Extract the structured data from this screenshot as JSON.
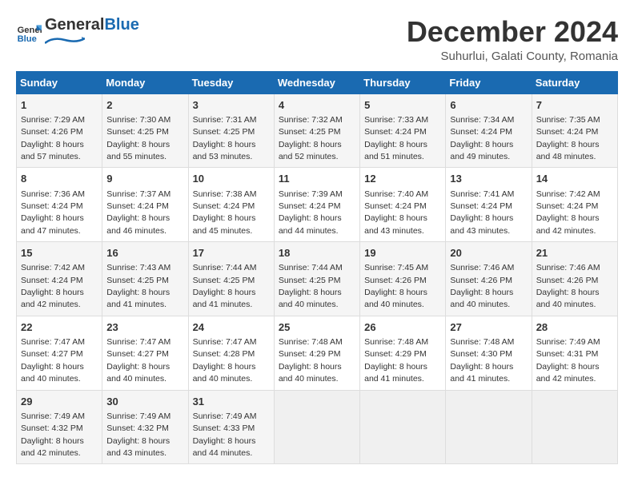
{
  "logo": {
    "text_general": "General",
    "text_blue": "Blue"
  },
  "title": "December 2024",
  "subtitle": "Suhurlui, Galati County, Romania",
  "weekdays": [
    "Sunday",
    "Monday",
    "Tuesday",
    "Wednesday",
    "Thursday",
    "Friday",
    "Saturday"
  ],
  "weeks": [
    [
      {
        "day": "1",
        "sunrise": "Sunrise: 7:29 AM",
        "sunset": "Sunset: 4:26 PM",
        "daylight": "Daylight: 8 hours and 57 minutes."
      },
      {
        "day": "2",
        "sunrise": "Sunrise: 7:30 AM",
        "sunset": "Sunset: 4:25 PM",
        "daylight": "Daylight: 8 hours and 55 minutes."
      },
      {
        "day": "3",
        "sunrise": "Sunrise: 7:31 AM",
        "sunset": "Sunset: 4:25 PM",
        "daylight": "Daylight: 8 hours and 53 minutes."
      },
      {
        "day": "4",
        "sunrise": "Sunrise: 7:32 AM",
        "sunset": "Sunset: 4:25 PM",
        "daylight": "Daylight: 8 hours and 52 minutes."
      },
      {
        "day": "5",
        "sunrise": "Sunrise: 7:33 AM",
        "sunset": "Sunset: 4:24 PM",
        "daylight": "Daylight: 8 hours and 51 minutes."
      },
      {
        "day": "6",
        "sunrise": "Sunrise: 7:34 AM",
        "sunset": "Sunset: 4:24 PM",
        "daylight": "Daylight: 8 hours and 49 minutes."
      },
      {
        "day": "7",
        "sunrise": "Sunrise: 7:35 AM",
        "sunset": "Sunset: 4:24 PM",
        "daylight": "Daylight: 8 hours and 48 minutes."
      }
    ],
    [
      {
        "day": "8",
        "sunrise": "Sunrise: 7:36 AM",
        "sunset": "Sunset: 4:24 PM",
        "daylight": "Daylight: 8 hours and 47 minutes."
      },
      {
        "day": "9",
        "sunrise": "Sunrise: 7:37 AM",
        "sunset": "Sunset: 4:24 PM",
        "daylight": "Daylight: 8 hours and 46 minutes."
      },
      {
        "day": "10",
        "sunrise": "Sunrise: 7:38 AM",
        "sunset": "Sunset: 4:24 PM",
        "daylight": "Daylight: 8 hours and 45 minutes."
      },
      {
        "day": "11",
        "sunrise": "Sunrise: 7:39 AM",
        "sunset": "Sunset: 4:24 PM",
        "daylight": "Daylight: 8 hours and 44 minutes."
      },
      {
        "day": "12",
        "sunrise": "Sunrise: 7:40 AM",
        "sunset": "Sunset: 4:24 PM",
        "daylight": "Daylight: 8 hours and 43 minutes."
      },
      {
        "day": "13",
        "sunrise": "Sunrise: 7:41 AM",
        "sunset": "Sunset: 4:24 PM",
        "daylight": "Daylight: 8 hours and 43 minutes."
      },
      {
        "day": "14",
        "sunrise": "Sunrise: 7:42 AM",
        "sunset": "Sunset: 4:24 PM",
        "daylight": "Daylight: 8 hours and 42 minutes."
      }
    ],
    [
      {
        "day": "15",
        "sunrise": "Sunrise: 7:42 AM",
        "sunset": "Sunset: 4:24 PM",
        "daylight": "Daylight: 8 hours and 42 minutes."
      },
      {
        "day": "16",
        "sunrise": "Sunrise: 7:43 AM",
        "sunset": "Sunset: 4:25 PM",
        "daylight": "Daylight: 8 hours and 41 minutes."
      },
      {
        "day": "17",
        "sunrise": "Sunrise: 7:44 AM",
        "sunset": "Sunset: 4:25 PM",
        "daylight": "Daylight: 8 hours and 41 minutes."
      },
      {
        "day": "18",
        "sunrise": "Sunrise: 7:44 AM",
        "sunset": "Sunset: 4:25 PM",
        "daylight": "Daylight: 8 hours and 40 minutes."
      },
      {
        "day": "19",
        "sunrise": "Sunrise: 7:45 AM",
        "sunset": "Sunset: 4:26 PM",
        "daylight": "Daylight: 8 hours and 40 minutes."
      },
      {
        "day": "20",
        "sunrise": "Sunrise: 7:46 AM",
        "sunset": "Sunset: 4:26 PM",
        "daylight": "Daylight: 8 hours and 40 minutes."
      },
      {
        "day": "21",
        "sunrise": "Sunrise: 7:46 AM",
        "sunset": "Sunset: 4:26 PM",
        "daylight": "Daylight: 8 hours and 40 minutes."
      }
    ],
    [
      {
        "day": "22",
        "sunrise": "Sunrise: 7:47 AM",
        "sunset": "Sunset: 4:27 PM",
        "daylight": "Daylight: 8 hours and 40 minutes."
      },
      {
        "day": "23",
        "sunrise": "Sunrise: 7:47 AM",
        "sunset": "Sunset: 4:27 PM",
        "daylight": "Daylight: 8 hours and 40 minutes."
      },
      {
        "day": "24",
        "sunrise": "Sunrise: 7:47 AM",
        "sunset": "Sunset: 4:28 PM",
        "daylight": "Daylight: 8 hours and 40 minutes."
      },
      {
        "day": "25",
        "sunrise": "Sunrise: 7:48 AM",
        "sunset": "Sunset: 4:29 PM",
        "daylight": "Daylight: 8 hours and 40 minutes."
      },
      {
        "day": "26",
        "sunrise": "Sunrise: 7:48 AM",
        "sunset": "Sunset: 4:29 PM",
        "daylight": "Daylight: 8 hours and 41 minutes."
      },
      {
        "day": "27",
        "sunrise": "Sunrise: 7:48 AM",
        "sunset": "Sunset: 4:30 PM",
        "daylight": "Daylight: 8 hours and 41 minutes."
      },
      {
        "day": "28",
        "sunrise": "Sunrise: 7:49 AM",
        "sunset": "Sunset: 4:31 PM",
        "daylight": "Daylight: 8 hours and 42 minutes."
      }
    ],
    [
      {
        "day": "29",
        "sunrise": "Sunrise: 7:49 AM",
        "sunset": "Sunset: 4:32 PM",
        "daylight": "Daylight: 8 hours and 42 minutes."
      },
      {
        "day": "30",
        "sunrise": "Sunrise: 7:49 AM",
        "sunset": "Sunset: 4:32 PM",
        "daylight": "Daylight: 8 hours and 43 minutes."
      },
      {
        "day": "31",
        "sunrise": "Sunrise: 7:49 AM",
        "sunset": "Sunset: 4:33 PM",
        "daylight": "Daylight: 8 hours and 44 minutes."
      },
      null,
      null,
      null,
      null
    ]
  ]
}
